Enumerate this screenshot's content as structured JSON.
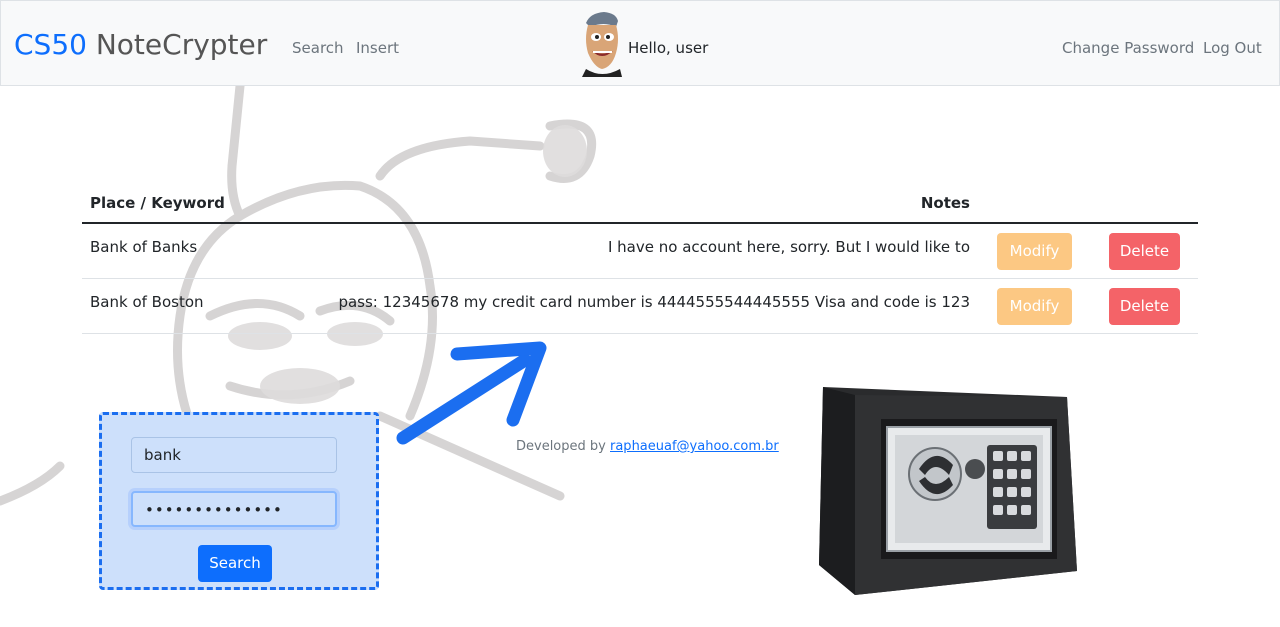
{
  "navbar": {
    "brand_part1": "CS50",
    "brand_part2": "NoteCrypter",
    "links": [
      "Search",
      "Insert"
    ],
    "greeting": "Hello, user",
    "right_links": [
      "Change Password",
      "Log Out"
    ]
  },
  "table": {
    "headers": [
      "Place / Keyword",
      "Notes"
    ],
    "rows": [
      {
        "place": "Bank of Banks",
        "notes": "I have no account here, sorry. But I would like to",
        "modify": "Modify",
        "delete": "Delete"
      },
      {
        "place": "Bank of Boston",
        "notes": "pass: 12345678 my credit card number is 4444555544445555 Visa and code is 123",
        "modify": "Modify",
        "delete": "Delete"
      }
    ]
  },
  "login_panel": {
    "username_value": "bank",
    "password_value": "••••••••••••••",
    "button_label": "Search"
  },
  "footer": {
    "prefix": "Developed by",
    "email": "raphaeuaf@yahoo.com.br"
  },
  "colors": {
    "primary": "#0d6efd",
    "modify": "#fcc883",
    "delete": "#f46368",
    "panel_bg": "#cde0fb"
  },
  "icons": [
    "avatar-caricature",
    "arrow-up-right-icon",
    "safe-illustration",
    "background-sketch"
  ]
}
